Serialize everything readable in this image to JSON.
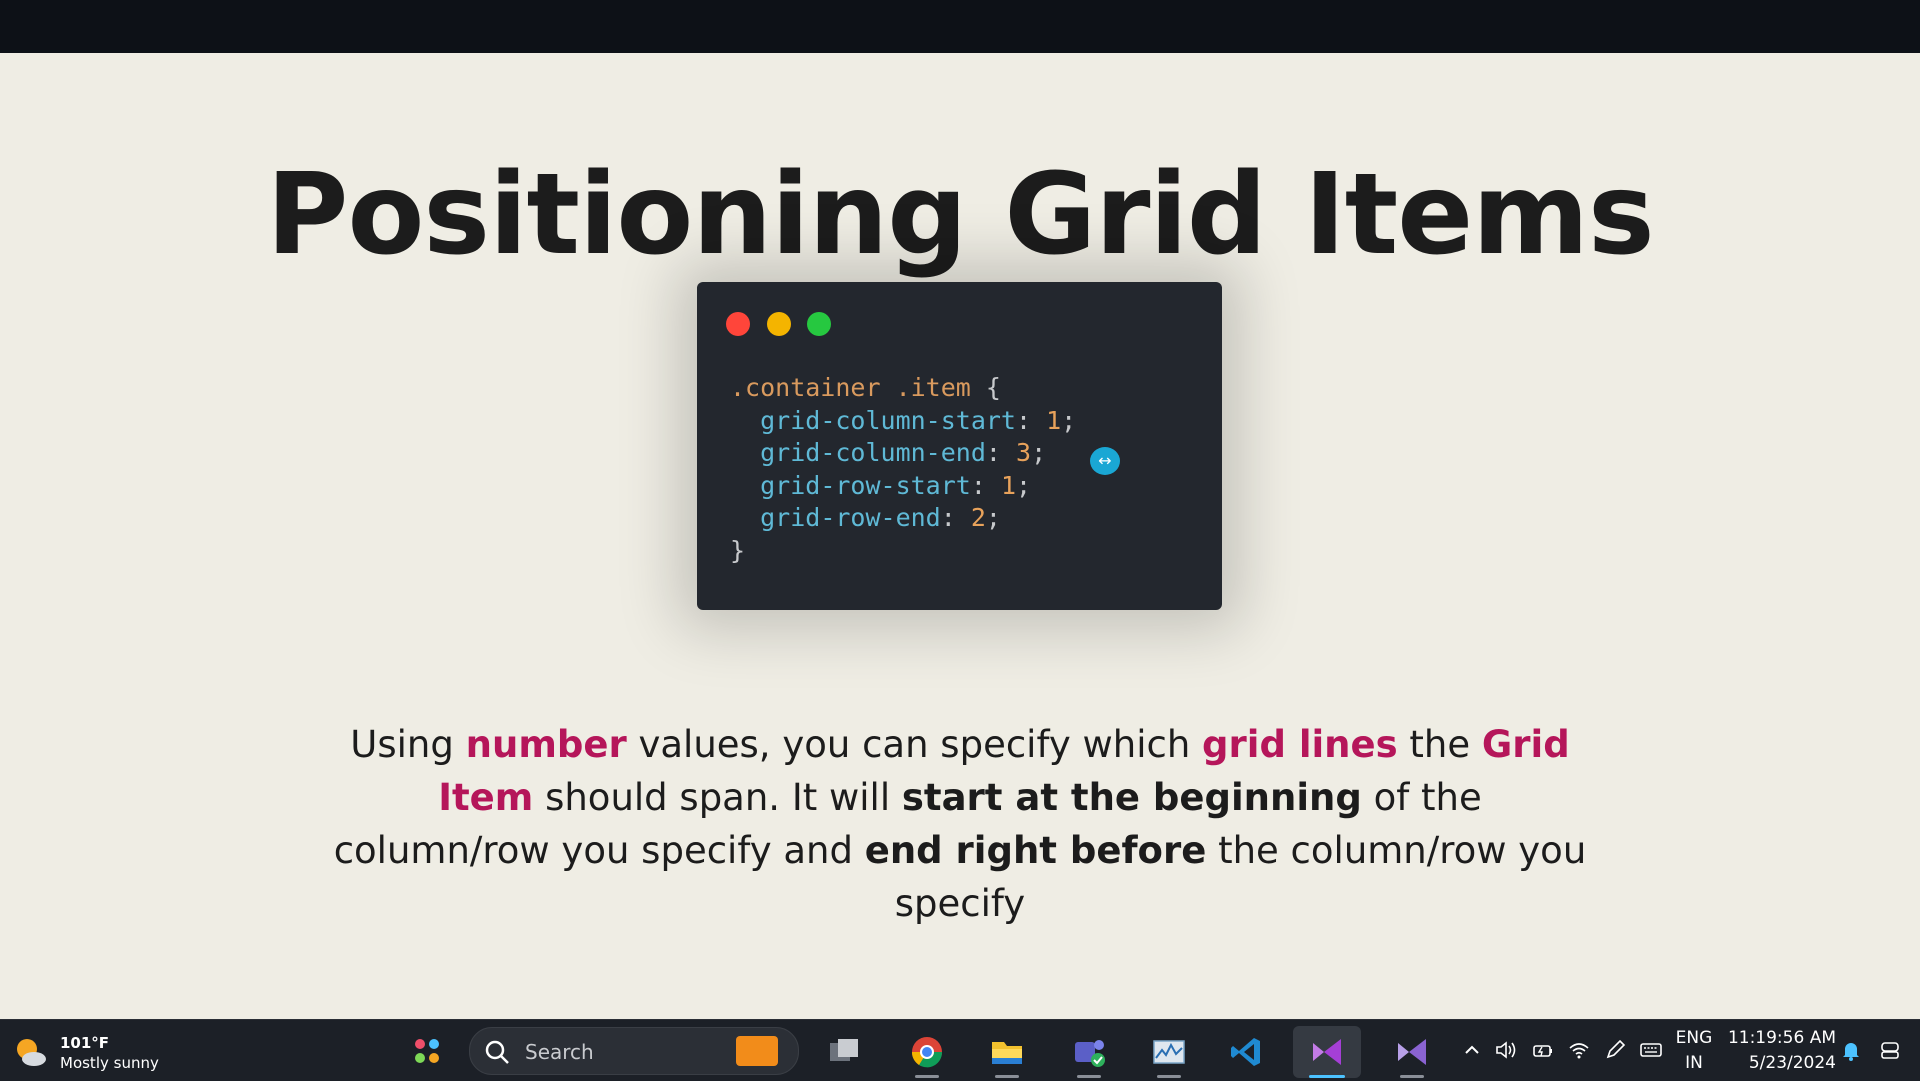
{
  "slide": {
    "title": "Positioning Grid Items",
    "code": {
      "selector": ".container .item",
      "open_brace": "{",
      "close_brace": "}",
      "lines": [
        {
          "prop": "grid-column-start",
          "value": "1"
        },
        {
          "prop": "grid-column-end",
          "value": "3"
        },
        {
          "prop": "grid-row-start",
          "value": "1"
        },
        {
          "prop": "grid-row-end",
          "value": "2"
        }
      ],
      "colon": ":",
      "semicolon": ";"
    },
    "description": {
      "p1": "Using ",
      "h1": "number",
      "p2": " values, you can specify which ",
      "h2": "grid lines",
      "p3": " the ",
      "h3": "Grid Item",
      "p4": " should span. It will ",
      "b1": "start at the beginning",
      "p5": " of the column/row you specify and ",
      "b2": "end right before",
      "p6": " the column/row you specify"
    },
    "colors": {
      "highlight": "#b5165a",
      "background": "#efede4",
      "code_bg": "#23272e"
    }
  },
  "taskbar": {
    "weather": {
      "temp": "101°F",
      "desc": "Mostly sunny",
      "icon": "sun-cloud-icon"
    },
    "search_placeholder": "Search",
    "apps": [
      {
        "name": "task-view",
        "icon": "task-view-icon"
      },
      {
        "name": "chrome",
        "icon": "chrome-icon"
      },
      {
        "name": "file-explorer",
        "icon": "folder-icon"
      },
      {
        "name": "teams",
        "icon": "teams-icon"
      },
      {
        "name": "performance-monitor",
        "icon": "monitor-icon"
      },
      {
        "name": "vscode",
        "icon": "vscode-icon"
      },
      {
        "name": "visual-studio",
        "icon": "visual-studio-icon"
      },
      {
        "name": "visual-studio-2",
        "icon": "visual-studio-icon"
      }
    ],
    "language": {
      "line1": "ENG",
      "line2": "IN"
    },
    "time": "11:19:56 AM",
    "date": "5/23/2024"
  }
}
